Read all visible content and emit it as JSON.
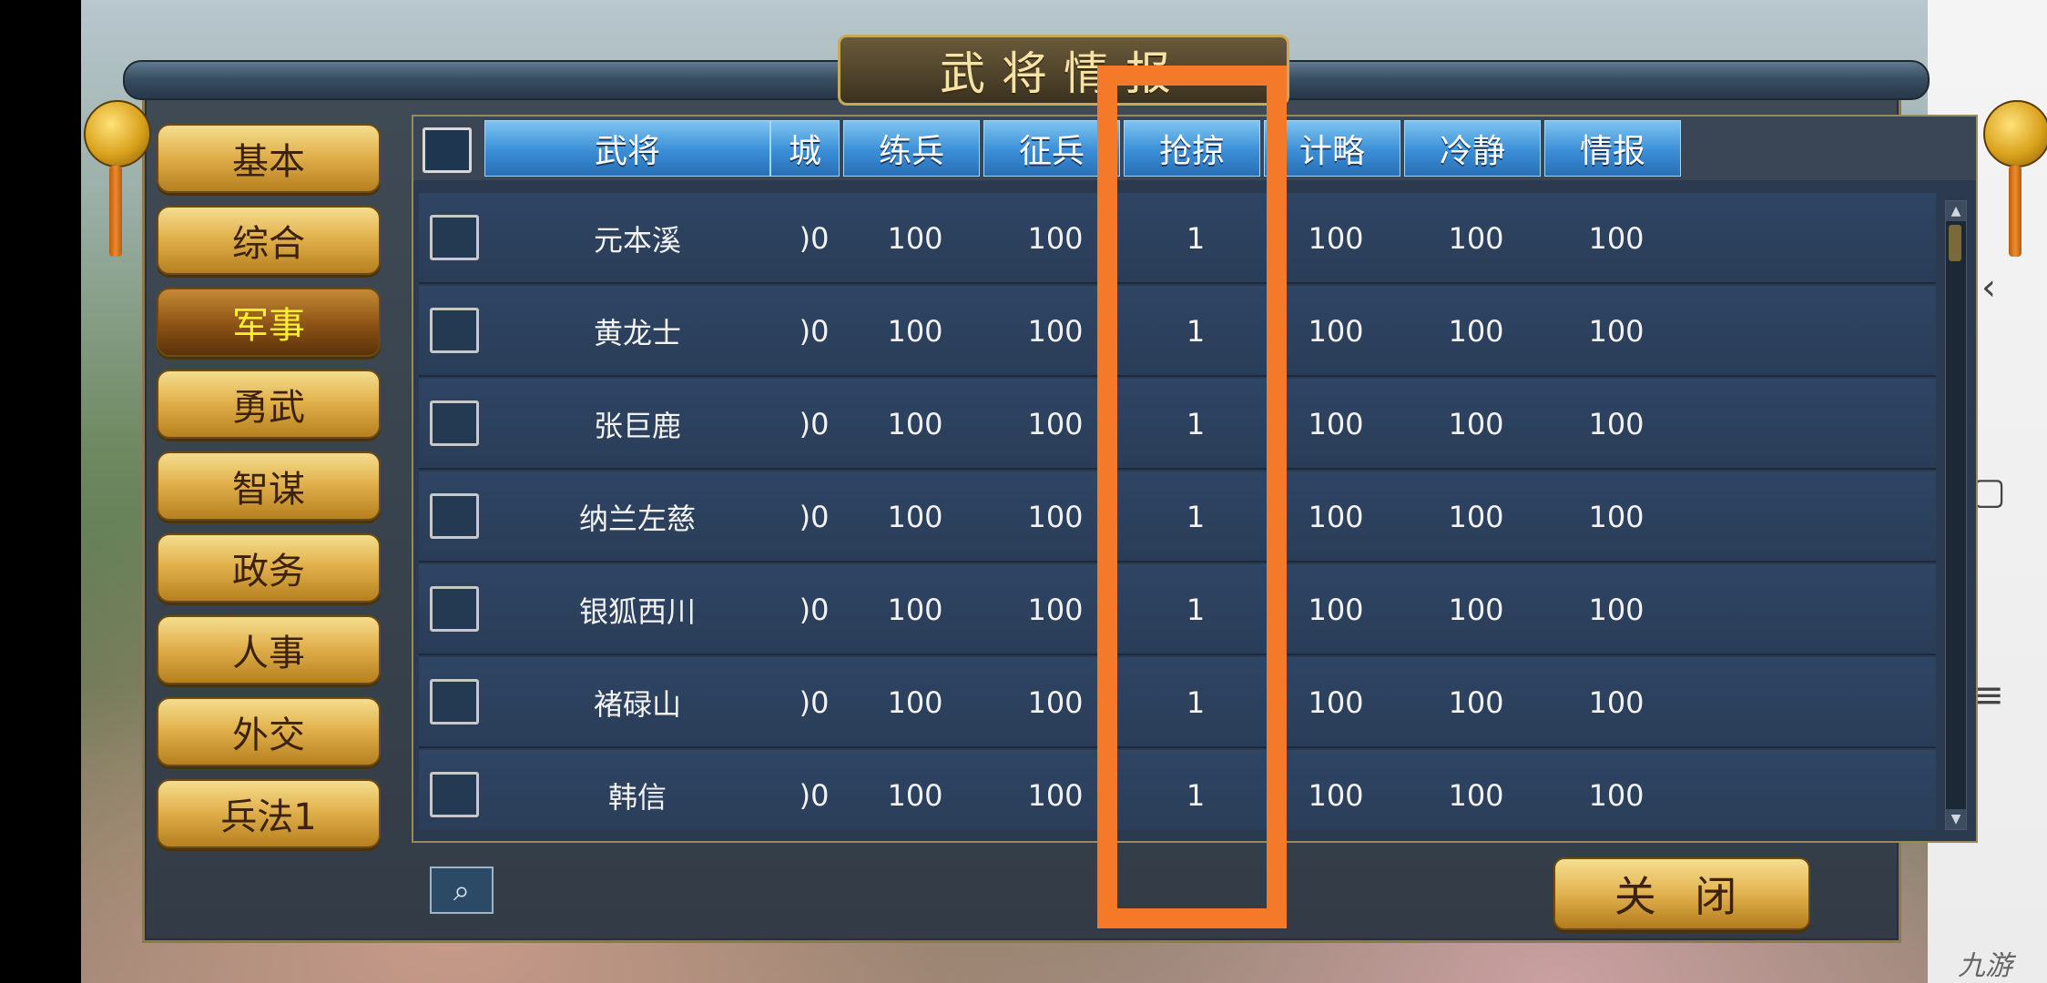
{
  "window": {
    "title": "武将情报"
  },
  "sidebar": {
    "items": [
      {
        "label": "基本",
        "active": false
      },
      {
        "label": "综合",
        "active": false
      },
      {
        "label": "军事",
        "active": true
      },
      {
        "label": "勇武",
        "active": false
      },
      {
        "label": "智谋",
        "active": false
      },
      {
        "label": "政务",
        "active": false
      },
      {
        "label": "人事",
        "active": false
      },
      {
        "label": "外交",
        "active": false
      },
      {
        "label": "兵法1",
        "active": false
      }
    ]
  },
  "table": {
    "headers": [
      "武将",
      "城",
      "练兵",
      "征兵",
      "抢掠",
      "计略",
      "冷静",
      "情报"
    ],
    "rows": [
      {
        "name": "元本溪",
        "col2": ")0",
        "col3": "100",
        "col4": "100",
        "col5": "1",
        "col6": "100",
        "col7": "100",
        "col8": "100"
      },
      {
        "name": "黄龙士",
        "col2": ")0",
        "col3": "100",
        "col4": "100",
        "col5": "1",
        "col6": "100",
        "col7": "100",
        "col8": "100"
      },
      {
        "name": "张巨鹿",
        "col2": ")0",
        "col3": "100",
        "col4": "100",
        "col5": "1",
        "col6": "100",
        "col7": "100",
        "col8": "100"
      },
      {
        "name": "纳兰左慈",
        "col2": ")0",
        "col3": "100",
        "col4": "100",
        "col5": "1",
        "col6": "100",
        "col7": "100",
        "col8": "100"
      },
      {
        "name": "银狐西川",
        "col2": ")0",
        "col3": "100",
        "col4": "100",
        "col5": "1",
        "col6": "100",
        "col7": "100",
        "col8": "100"
      },
      {
        "name": "褚碌山",
        "col2": ")0",
        "col3": "100",
        "col4": "100",
        "col5": "1",
        "col6": "100",
        "col7": "100",
        "col8": "100"
      },
      {
        "name": "韩信",
        "col2": ")0",
        "col3": "100",
        "col4": "100",
        "col5": "1",
        "col6": "100",
        "col7": "100",
        "col8": "100"
      }
    ]
  },
  "footer": {
    "close_label": "关 闭"
  },
  "colors": {
    "highlight": "#f47a2a",
    "active_text": "#ffee33"
  },
  "android_nav": {
    "back": "‹",
    "home": "▢",
    "menu": "≡"
  },
  "watermark": "九游"
}
